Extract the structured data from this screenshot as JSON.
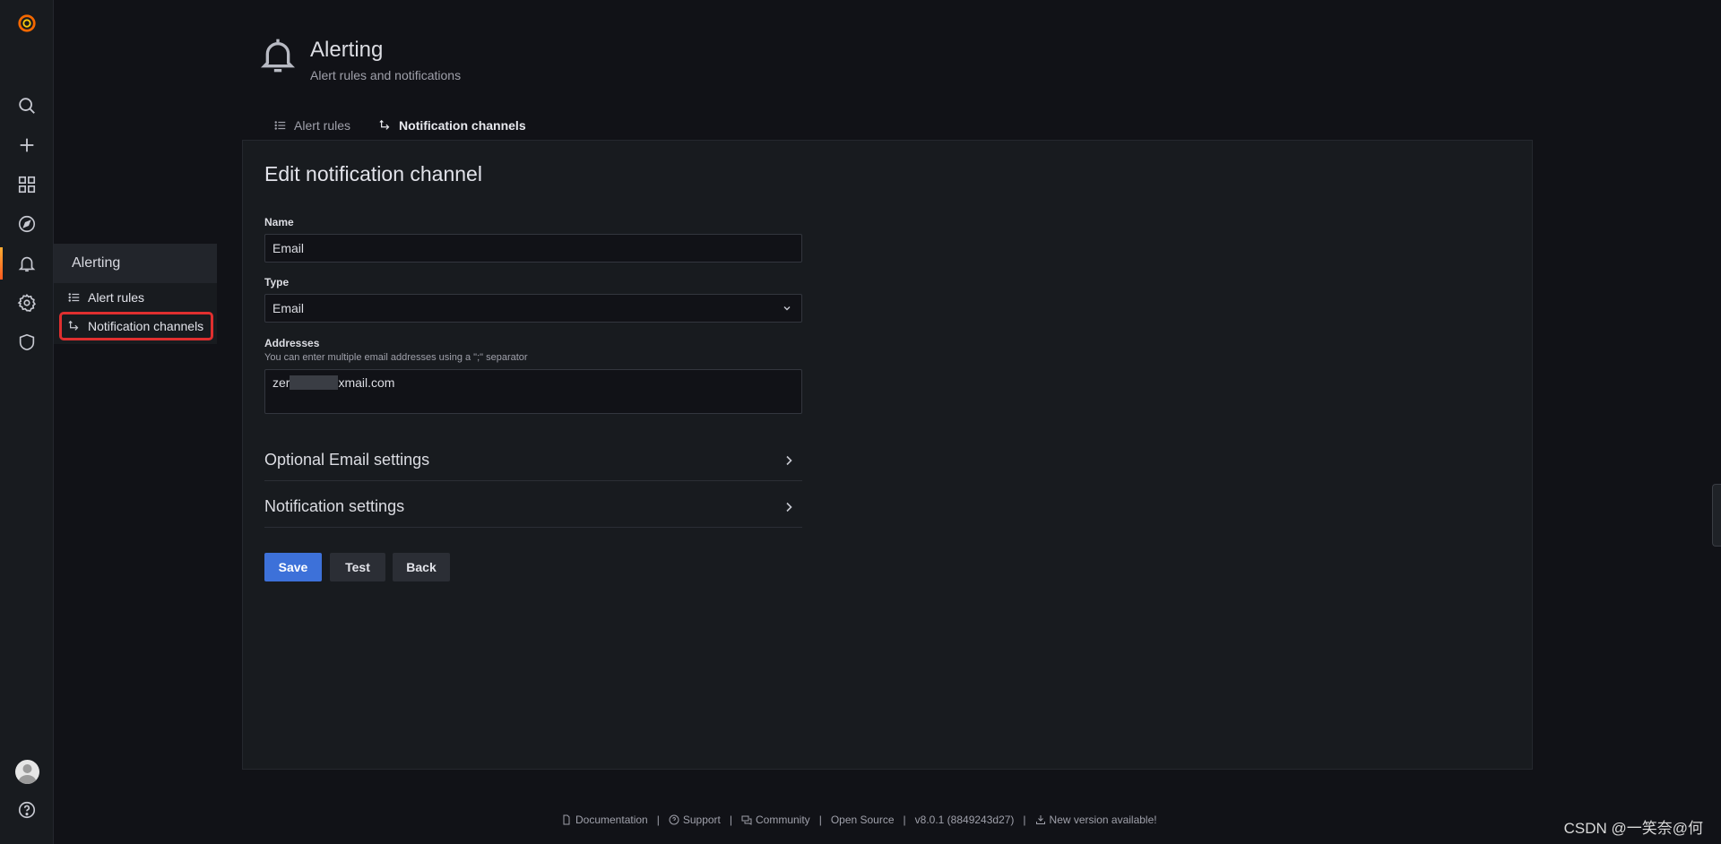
{
  "sidebar": {
    "icons": [
      "grafana-logo-icon",
      "search-icon",
      "plus-icon",
      "dashboards-icon",
      "explore-icon",
      "bell-icon",
      "gear-icon",
      "shield-icon",
      "avatar",
      "help-icon"
    ],
    "active": "bell-icon"
  },
  "submenu": {
    "title": "Alerting",
    "items": [
      {
        "label": "Alert rules",
        "icon": "list-icon"
      },
      {
        "label": "Notification channels",
        "icon": "channel-icon"
      }
    ]
  },
  "header": {
    "title": "Alerting",
    "subtitle": "Alert rules and notifications"
  },
  "tabs": [
    {
      "label": "Alert rules",
      "active": false
    },
    {
      "label": "Notification channels",
      "active": true
    }
  ],
  "form": {
    "title": "Edit notification channel",
    "name_label": "Name",
    "name_value": "Email",
    "type_label": "Type",
    "type_value": "Email",
    "addresses_label": "Addresses",
    "addresses_desc": "You can enter multiple email addresses using a \";\" separator",
    "addresses_prefix": "zer",
    "addresses_suffix": "xmail.com",
    "optional_settings": "Optional Email settings",
    "notification_settings": "Notification settings",
    "save_label": "Save",
    "test_label": "Test",
    "back_label": "Back"
  },
  "footer": {
    "documentation": "Documentation",
    "support": "Support",
    "community": "Community",
    "open_source": "Open Source",
    "version": "v8.0.1 (8849243d27)",
    "new_version": "New version available!",
    "separator": "|"
  },
  "watermark": "CSDN @‪一笑奈@何",
  "colors": {
    "accent": "#f0742f",
    "primary_button": "#3d71d9",
    "highlight_box": "#e02f2f"
  }
}
